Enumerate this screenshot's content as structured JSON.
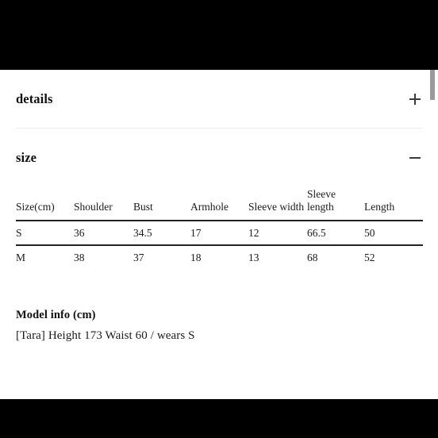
{
  "window": {
    "background_color": "#000000",
    "page_background": "#ffffff"
  },
  "accordions": [
    {
      "title": "details",
      "toggle_icon": "plus-icon",
      "toggle_symbol": "+",
      "expanded": false
    },
    {
      "title": "size",
      "toggle_icon": "minus-icon",
      "toggle_symbol": "-",
      "expanded": true
    }
  ],
  "size_table": {
    "headers": [
      "Size(cm)",
      "Shoulder",
      "Bust",
      "Armhole",
      "Sleeve width",
      "Sleeve length",
      "Length"
    ],
    "rows": [
      {
        "size": "S",
        "shoulder": "36",
        "bust": "34.5",
        "armhole": "17",
        "sleeve_width": "12",
        "sleeve_length": "66.5",
        "length": "50"
      },
      {
        "size": "M",
        "shoulder": "38",
        "bust": "37",
        "armhole": "18",
        "sleeve_width": "13",
        "sleeve_length": "68",
        "length": "52"
      }
    ]
  },
  "model_info": {
    "title": "Model info (cm)",
    "line": "[Tara] Height 173 Waist 60 / wears S"
  },
  "scrollbar": {
    "icon": "scrollbar-thumb",
    "color": "#9a9a9a"
  }
}
